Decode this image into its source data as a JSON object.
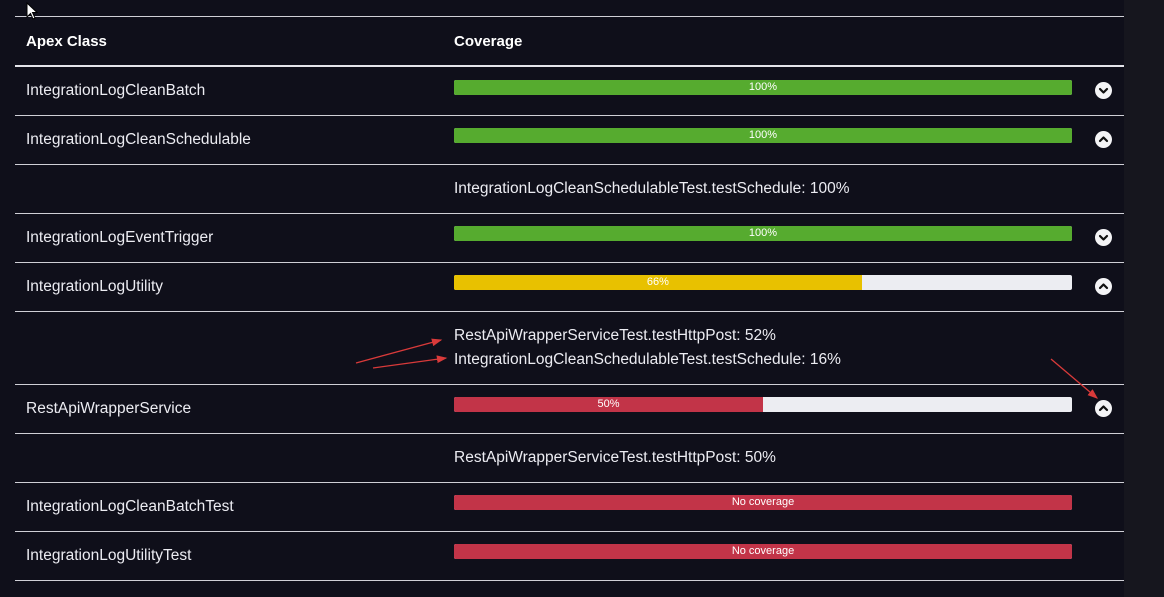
{
  "table": {
    "headers": {
      "apex_class": "Apex Class",
      "coverage": "Coverage"
    },
    "rows": [
      {
        "class_name": "IntegrationLogCleanBatch",
        "coverage_label": "100%",
        "coverage_fraction": 1.0,
        "bar_color": "#56ab2f",
        "toggle": "expand",
        "details": []
      },
      {
        "class_name": "IntegrationLogCleanSchedulable",
        "coverage_label": "100%",
        "coverage_fraction": 1.0,
        "bar_color": "#56ab2f",
        "toggle": "collapse",
        "details": [
          "IntegrationLogCleanSchedulableTest.testSchedule: 100%"
        ]
      },
      {
        "class_name": "IntegrationLogEventTrigger",
        "coverage_label": "100%",
        "coverage_fraction": 1.0,
        "bar_color": "#56ab2f",
        "toggle": "expand",
        "details": []
      },
      {
        "class_name": "IntegrationLogUtility",
        "coverage_label": "66%",
        "coverage_fraction": 0.66,
        "bar_color": "#e8c100",
        "toggle": "collapse",
        "details": [
          "RestApiWrapperServiceTest.testHttpPost: 52%",
          "IntegrationLogCleanSchedulableTest.testSchedule: 16%"
        ]
      },
      {
        "class_name": "RestApiWrapperService",
        "coverage_label": "50%",
        "coverage_fraction": 0.5,
        "bar_color": "#c23448",
        "toggle": "collapse",
        "details": [
          "RestApiWrapperServiceTest.testHttpPost: 50%"
        ]
      },
      {
        "class_name": "IntegrationLogCleanBatchTest",
        "coverage_label": "No coverage",
        "coverage_fraction": 0,
        "bar_color": "#c23448",
        "toggle": "none",
        "details": []
      },
      {
        "class_name": "IntegrationLogUtilityTest",
        "coverage_label": "No coverage",
        "coverage_fraction": 0,
        "bar_color": "#c23448",
        "toggle": "none",
        "details": []
      }
    ]
  },
  "colors": {
    "background": "#0f0f1a",
    "divider": "#cfcfd6",
    "bar_track": "#ecedf2",
    "annotation_arrow": "#d93a3a"
  },
  "icons": {
    "expand": "chevron-down-icon",
    "collapse": "chevron-up-icon",
    "cursor": "mouse-pointer-icon"
  }
}
